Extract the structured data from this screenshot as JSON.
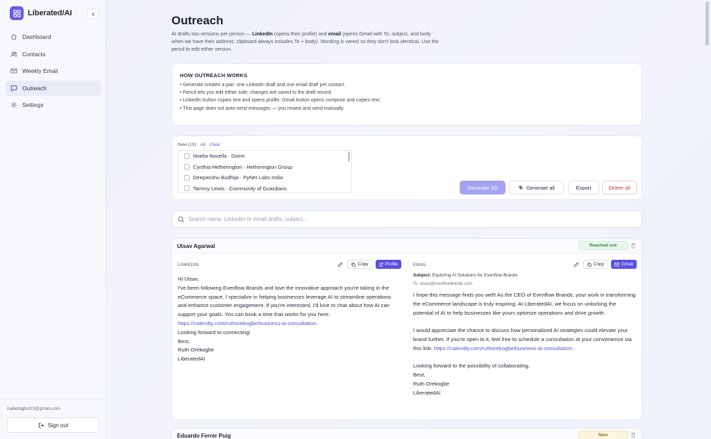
{
  "brand": {
    "name": "Liberated/AI"
  },
  "sidebar": {
    "items": [
      {
        "label": "Dashboard",
        "icon": "home-icon",
        "active": false
      },
      {
        "label": "Contacts",
        "icon": "users-icon",
        "active": false
      },
      {
        "label": "Weekly Email",
        "icon": "mail-icon",
        "active": false
      },
      {
        "label": "Outreach",
        "icon": "message-icon",
        "active": true
      },
      {
        "label": "Settings",
        "icon": "gear-icon",
        "active": false
      }
    ],
    "user_email": "isabelagbul13@gmail.com",
    "sign_out_label": "Sign out"
  },
  "page": {
    "title": "Outreach",
    "description_parts": [
      "AI drafts two versions per person — ",
      "LinkedIn",
      " (opens their profile) and ",
      "email",
      " (opens Gmail with To, subject, and body when we have their address; clipboard always includes To + body). Wording is varied so they don't look identical. Use the pencil to edit either version."
    ]
  },
  "how_it_works": {
    "title": "HOW OUTREACH WORKS",
    "items": [
      "• Generate creates a pair: one LinkedIn draft and one email draft per contact.",
      "• Pencil lets you edit either side; changes are saved to the draft record.",
      "• LinkedIn button copies text and opens profile; Gmail button opens compose and copies text.",
      "• This page does not auto-send messages — you review and send manually."
    ]
  },
  "filter": {
    "new_label": "New (19)",
    "all_label": "All",
    "clear_label": "Clear",
    "contacts": [
      "Noelia Novella · Doinn",
      "Cynthia Hetherington · Hetherington Group",
      "Deepanshu Budhija · PyNet Labs India",
      "Tammy Lewis · Community of Guardians"
    ],
    "generate_label": "Generate (0)",
    "generate_all_label": "Generate all",
    "export_label": "Export",
    "delete_all_label": "Delete all"
  },
  "search": {
    "placeholder": "Search name, LinkedIn or email drafts, subject..."
  },
  "drafts": [
    {
      "name": "Utsav Agarwal",
      "status": "Reached out",
      "linkedin": {
        "label": "LINKEDIN",
        "copy_label": "Copy",
        "profile_label": "Profile",
        "body_lines": [
          "Hi Utsav,",
          "I've been following Evenflow Brands and love the innovative approach you're taking in the eCommerce space. I specialize in helping businesses leverage AI to streamline operations and enhance customer engagement. If you're interested, I'd love to chat about how AI can support your goals. You can book a time that works for you here: "
        ],
        "link": "https://calendly.com/ruthorekogbe/business-ai-consultation",
        "closing": ".\nLooking forward to connecting!\nBest,\nRuth Orekogbe\nLiberatedAI"
      },
      "email": {
        "label": "EMAIL",
        "copy_label": "Copy",
        "gmail_label": "Gmail",
        "subject_label": "Subject:",
        "subject": "Exploring AI Solutions for Evenflow Brands",
        "to": "To: utsav@evenflowbrands.com",
        "body_part1": "I hope this message finds you well! As the CEO of Evenflow Brands, your work in transforming the eCommerce landscape is truly inspiring. At LiberatedAI, we focus on unlocking the potential of AI to help businesses like yours optimize operations and drive growth.\n\nI would appreciate the chance to discuss how personalized AI strategies could elevate your brand further. If you're open to it, feel free to schedule a consultation at your convenience via this link: ",
        "link": "https://calendly.com/ruthorekogbe/business-ai-consultation",
        "body_part2": ".\n\nLooking forward to the possibility of collaborating.\nBest,\nRuth Orekogbe\nLiberatedAI"
      }
    },
    {
      "name": "Eduardo Ferrer Puig",
      "status": "New"
    }
  ]
}
